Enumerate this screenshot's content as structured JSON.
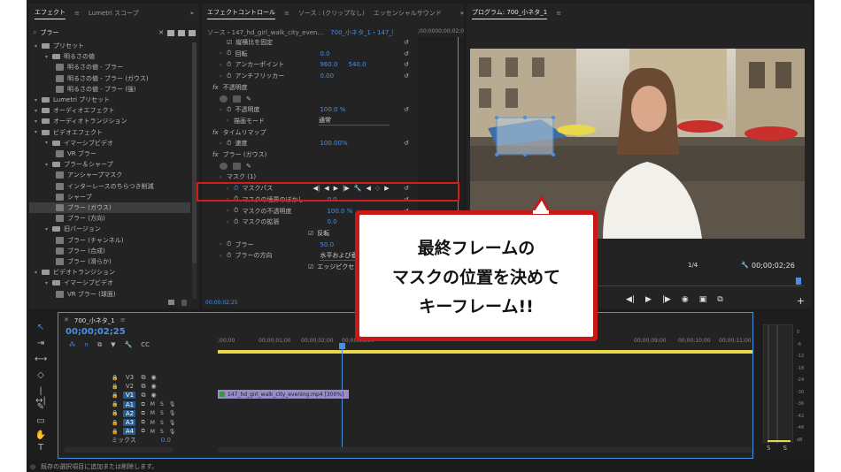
{
  "effects_panel": {
    "tabs": [
      "エフェクト",
      "Lumetri スコープ"
    ],
    "search_value": "ブラー",
    "tree": [
      {
        "label": "プリセット",
        "level": 0,
        "kind": "folder"
      },
      {
        "label": "明るさの値",
        "level": 1,
        "kind": "folder"
      },
      {
        "label": "明るさの値 - ブラー",
        "level": 2,
        "kind": "fx"
      },
      {
        "label": "明るさの値 - ブラー (ガウス)",
        "level": 2,
        "kind": "fx"
      },
      {
        "label": "明るさの値 - ブラー (強)",
        "level": 2,
        "kind": "fx"
      },
      {
        "label": "Lumetri プリセット",
        "level": 0,
        "kind": "folder"
      },
      {
        "label": "オーディオエフェクト",
        "level": 0,
        "kind": "folder"
      },
      {
        "label": "オーディオトランジション",
        "level": 0,
        "kind": "folder"
      },
      {
        "label": "ビデオエフェクト",
        "level": 0,
        "kind": "folder"
      },
      {
        "label": "イマーシブビデオ",
        "level": 1,
        "kind": "folder"
      },
      {
        "label": "VR ブラー",
        "level": 2,
        "kind": "fx"
      },
      {
        "label": "ブラー＆シャープ",
        "level": 1,
        "kind": "folder"
      },
      {
        "label": "アンシャープマスク",
        "level": 2,
        "kind": "fx"
      },
      {
        "label": "インターレースのちらつき削減",
        "level": 2,
        "kind": "fx"
      },
      {
        "label": "シャープ",
        "level": 2,
        "kind": "fx"
      },
      {
        "label": "ブラー (ガウス)",
        "level": 2,
        "kind": "fx",
        "selected": true
      },
      {
        "label": "ブラー (方向)",
        "level": 2,
        "kind": "fx"
      },
      {
        "label": "旧バージョン",
        "level": 1,
        "kind": "folder"
      },
      {
        "label": "ブラー (チャンネル)",
        "level": 2,
        "kind": "fx"
      },
      {
        "label": "ブラー (合成)",
        "level": 2,
        "kind": "fx"
      },
      {
        "label": "ブラー (滑らか)",
        "level": 2,
        "kind": "fx"
      },
      {
        "label": "ビデオトランジション",
        "level": 0,
        "kind": "folder"
      },
      {
        "label": "イマーシブビデオ",
        "level": 1,
        "kind": "folder"
      },
      {
        "label": "VR ブラー (球面)",
        "level": 2,
        "kind": "fx"
      }
    ]
  },
  "effect_controls": {
    "tabs": [
      "エフェクトコントロール",
      "ソース : (クリップなし)",
      "エッセンシャルサウンド"
    ],
    "source_label": "ソース・147_hd_girl_walk_city_even...",
    "seq_label": "700_小ネタ_1・147_hd_girl_walk...",
    "mini_time": ";00;00",
    "mini_time2": "00;00;02;00",
    "rows": [
      {
        "label": "縦横比を固定",
        "value": "",
        "indent": 3,
        "checkbox": true
      },
      {
        "label": "回転",
        "value": "0.0",
        "indent": 2,
        "stopwatch": true
      },
      {
        "label": "アンカーポイント",
        "value": "960.0",
        "value2": "540.0",
        "indent": 2,
        "stopwatch": true
      },
      {
        "label": "アンチフリッカー",
        "value": "0.00",
        "indent": 2,
        "stopwatch": true
      },
      {
        "label": "不透明度",
        "value": "",
        "indent": 1,
        "fx": true
      },
      {
        "label": "",
        "value": "",
        "indent": 2,
        "shapes": true
      },
      {
        "label": "不透明度",
        "value": "100.0 %",
        "indent": 2,
        "stopwatch": true
      },
      {
        "label": "描画モード",
        "value": "通常",
        "indent": 3,
        "dropdown": true
      },
      {
        "label": "タイムリマップ",
        "value": "",
        "indent": 1,
        "fx": true
      },
      {
        "label": "速度",
        "value": "100.00%",
        "indent": 2,
        "stopwatch": true
      },
      {
        "label": "ブラー (ガウス)",
        "value": "",
        "indent": 1,
        "fx": true
      },
      {
        "label": "",
        "value": "",
        "indent": 2,
        "shapes": true
      },
      {
        "label": "マスク (1)",
        "value": "",
        "indent": 2
      },
      {
        "label": "マスクパス",
        "value": "",
        "indent": 3,
        "stopwatch": true,
        "maskpath": true
      },
      {
        "label": "マスクの境界のぼかし",
        "value": "0.0",
        "indent": 3,
        "stopwatch": true
      },
      {
        "label": "マスクの不透明度",
        "value": "100.0 %",
        "indent": 3,
        "stopwatch": true
      },
      {
        "label": "マスクの拡張",
        "value": "0.0",
        "indent": 3,
        "stopwatch": true
      },
      {
        "label": "",
        "value": "反転",
        "indent": 3,
        "checkbox2": true
      },
      {
        "label": "ブラー",
        "value": "50.0",
        "indent": 2,
        "stopwatch": true
      },
      {
        "label": "ブラーの方向",
        "value": "水平および垂直",
        "indent": 2,
        "stopwatch": true,
        "dropdown": true
      },
      {
        "label": "",
        "value": "エッジピクセルを繰り",
        "indent": 2,
        "checkbox2": true
      }
    ],
    "footer_time": "00;00;02;25"
  },
  "program": {
    "title": "プログラム: 700_小ネタ_1",
    "zoom": "1/4",
    "timecode": "00;00;02;26"
  },
  "timeline": {
    "tab": "700_小ネタ_1",
    "timecode": "00;00;02;25",
    "ruler": [
      ";00;00",
      "00;00;01;00",
      "00;00;02;00",
      "00;00;03;00",
      "00;00;09;00",
      "00;00;10;00",
      "00;00;11;00",
      "00;00;1"
    ],
    "video_tracks": [
      "V3",
      "V2",
      "V1"
    ],
    "audio_tracks": [
      "A1",
      "A2",
      "A3",
      "A4"
    ],
    "mix_label": "ミックス",
    "mix_value": "0.0",
    "clip_label": "147_hd_girl_walk_city_evening.mp4 [300%]"
  },
  "meter": {
    "labels": [
      "0",
      "-6",
      "-12",
      "-18",
      "-24",
      "-30",
      "-36",
      "-42",
      "-48",
      "dB"
    ],
    "solo": [
      "S",
      "S"
    ]
  },
  "status_text": "既存の選択項目に追加または削除します。",
  "callout": {
    "lines": [
      "最終フレームの",
      "マスクの位置を決めて",
      "キーフレーム!!"
    ]
  },
  "colors": {
    "accent_blue": "#4a90e2",
    "callout_red": "#c81818",
    "clip_purple": "#9a8cc8"
  }
}
